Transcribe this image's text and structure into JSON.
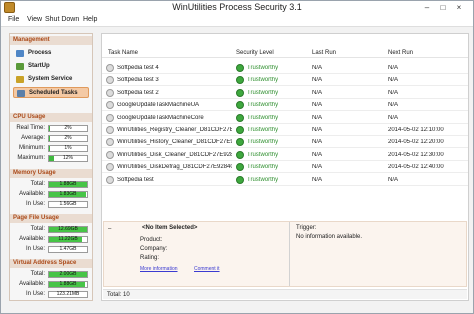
{
  "window": {
    "title": "WinUtilities Process Security 3.1"
  },
  "menu": [
    "File",
    "View",
    "Shut Down",
    "Help"
  ],
  "sidebar": {
    "management_header": "Management",
    "items": [
      {
        "label": "Process",
        "icon": "process-icon"
      },
      {
        "label": "StartUp",
        "icon": "startup-icon"
      },
      {
        "label": "System Service",
        "icon": "service-icon"
      },
      {
        "label": "Scheduled Tasks",
        "icon": "scheduled-tasks-icon",
        "active": true
      }
    ],
    "cpu": {
      "header": "CPU Usage",
      "rows": [
        {
          "label": "Real Time:",
          "value": "2%",
          "level": 0.02
        },
        {
          "label": "Average:",
          "value": "2%",
          "level": 0.02
        },
        {
          "label": "Minimum:",
          "value": "1%",
          "level": 0.01
        },
        {
          "label": "Maximum:",
          "value": "12%",
          "level": 0.12
        }
      ]
    },
    "memory": {
      "header": "Memory Usage",
      "rows": [
        {
          "label": "Total:",
          "value": "1.88GB",
          "level": 1.0
        },
        {
          "label": "Available:",
          "value": "1.83GB",
          "level": 0.97
        },
        {
          "label": "In Use:",
          "value": "1.56GB",
          "level": 0.0
        }
      ]
    },
    "pagefile": {
      "header": "Page File Usage",
      "rows": [
        {
          "label": "Total:",
          "value": "12.69GB",
          "level": 1.0
        },
        {
          "label": "Available:",
          "value": "11.22GB",
          "level": 0.88
        },
        {
          "label": "In Use:",
          "value": "1.47GB",
          "level": 0.0
        }
      ]
    },
    "virtual": {
      "header": "Virtual Address Space",
      "rows": [
        {
          "label": "Total:",
          "value": "2.00GB",
          "level": 1.0
        },
        {
          "label": "Available:",
          "value": "1.88GB",
          "level": 0.94
        },
        {
          "label": "In Use:",
          "value": "123.21MB",
          "level": 0.0
        }
      ]
    }
  },
  "table": {
    "columns": [
      "Task Name",
      "Security Level",
      "Last Run",
      "Next Run"
    ],
    "rows": [
      {
        "name": "Softpedia test 4",
        "security": "Trustworthy",
        "last_run": "N/A",
        "next_run": "N/A"
      },
      {
        "name": "Softpedia test 3",
        "security": "Trustworthy",
        "last_run": "N/A",
        "next_run": "N/A"
      },
      {
        "name": "Softpedia test 2",
        "security": "Trustworthy",
        "last_run": "N/A",
        "next_run": "N/A"
      },
      {
        "name": "GoogleUpdateTaskMachineUA",
        "security": "Trustworthy",
        "last_run": "N/A",
        "next_run": "N/A"
      },
      {
        "name": "GoogleUpdateTaskMachineCore",
        "security": "Trustworthy",
        "last_run": "N/A",
        "next_run": "N/A"
      },
      {
        "name": "WinUtilities_Registry_Cleaner_D81CDF27E928...",
        "security": "Trustworthy",
        "last_run": "N/A",
        "next_run": "2014-05-02 12:10:00"
      },
      {
        "name": "WinUtilities_History_Cleaner_D81CDF27E928...",
        "security": "Trustworthy",
        "last_run": "N/A",
        "next_run": "2014-05-02 12:20:00"
      },
      {
        "name": "WinUtilities_Disk_Cleaner_D81CDF27E928401",
        "security": "Trustworthy",
        "last_run": "N/A",
        "next_run": "2014-05-02 12:30:00"
      },
      {
        "name": "WinUtilities_DiskDefrag_D81CDF27E928401",
        "security": "Trustworthy",
        "last_run": "N/A",
        "next_run": "2014-05-02 12:40:00"
      },
      {
        "name": "Softpedia test",
        "security": "Trustworthy",
        "last_run": "N/A",
        "next_run": "N/A"
      }
    ]
  },
  "details": {
    "no_selection": "<No Item Selected>",
    "product_label": "Product:",
    "company_label": "Company:",
    "rating_label": "Rating:",
    "more_info_link": "More information",
    "comment_link": "Comment it",
    "trigger_label": "Trigger:",
    "trigger_value": "No information available."
  },
  "status": {
    "total": "Total: 10"
  },
  "colors": {
    "accent": "#ab4a19",
    "trust": "#3ea83e",
    "meter": "#47c447"
  }
}
